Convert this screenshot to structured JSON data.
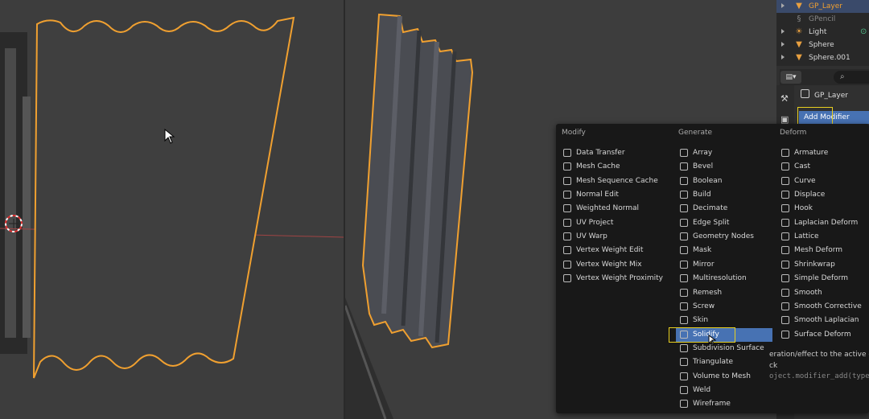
{
  "outliner": {
    "items": [
      {
        "label": "GP_Layer",
        "icon": "triangle-icon",
        "color": "#e8a040",
        "selected": true
      },
      {
        "label": "GPencil",
        "icon": "gpencil-icon",
        "color": "#888888",
        "selected": false
      },
      {
        "label": "Light",
        "icon": "light-icon",
        "color": "#d8d8d8",
        "selected": false
      },
      {
        "label": "Sphere",
        "icon": "triangle-icon",
        "color": "#d8d8d8",
        "selected": false
      },
      {
        "label": "Sphere.001",
        "icon": "triangle-icon",
        "color": "#d8d8d8",
        "selected": false
      }
    ]
  },
  "properties": {
    "object_name": "GP_Layer",
    "add_modifier_label": "Add Modifier",
    "search_icon": "search-icon"
  },
  "menu": {
    "columns": [
      {
        "title": "Modify",
        "items": [
          "Data Transfer",
          "Mesh Cache",
          "Mesh Sequence Cache",
          "Normal Edit",
          "Weighted Normal",
          "UV Project",
          "UV Warp",
          "Vertex Weight Edit",
          "Vertex Weight Mix",
          "Vertex Weight Proximity"
        ]
      },
      {
        "title": "Generate",
        "items": [
          "Array",
          "Bevel",
          "Boolean",
          "Build",
          "Decimate",
          "Edge Split",
          "Geometry Nodes",
          "Mask",
          "Mirror",
          "Multiresolution",
          "Remesh",
          "Screw",
          "Skin",
          "Solidify",
          "Subdivision Surface",
          "Triangulate",
          "Volume to Mesh",
          "Weld",
          "Wireframe"
        ]
      },
      {
        "title": "Deform",
        "items": [
          "Armature",
          "Cast",
          "Curve",
          "Displace",
          "Hook",
          "Laplacian Deform",
          "Lattice",
          "Mesh Deform",
          "Shrinkwrap",
          "Simple Deform",
          "Smooth",
          "Smooth Corrective",
          "Smooth Laplacian",
          "Surface Deform"
        ]
      }
    ],
    "highlighted": "Solidify"
  },
  "tooltip": {
    "line1": "eration/effect to the active objec",
    "line2": "ck",
    "line3": "oject.modifier_add(type='SO"
  },
  "colors": {
    "outline": "#f0a030",
    "highlight": "#4772b3",
    "annotation": "#e8d020"
  }
}
